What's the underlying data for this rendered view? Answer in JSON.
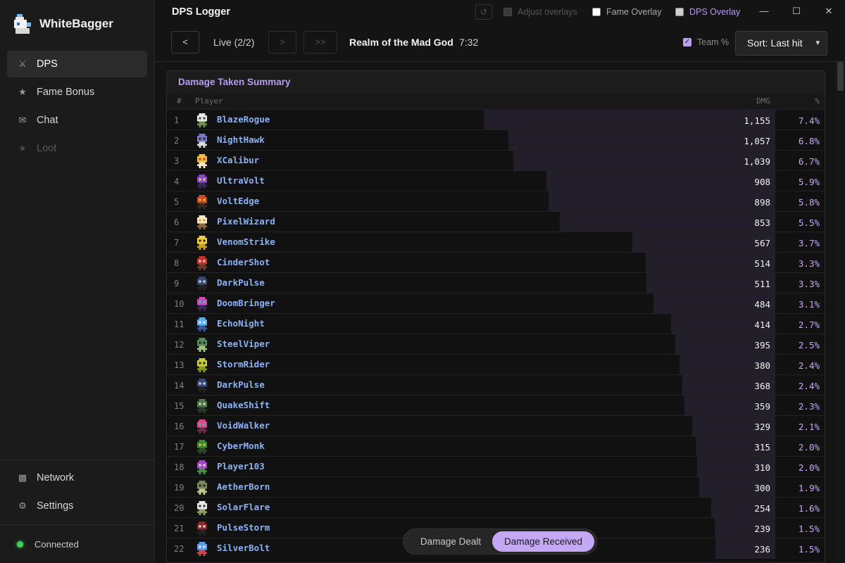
{
  "sidebar": {
    "brand": "WhiteBagger",
    "items": [
      {
        "label": "DPS",
        "icon": "sword-icon",
        "glyph": "⚔"
      },
      {
        "label": "Fame Bonus",
        "icon": "star-icon",
        "glyph": "★"
      },
      {
        "label": "Chat",
        "icon": "mail-icon",
        "glyph": "✉"
      },
      {
        "label": "Loot",
        "icon": "star-icon",
        "glyph": "★"
      }
    ],
    "bottom_items": [
      {
        "label": "Network",
        "icon": "network-icon",
        "glyph": "▩"
      },
      {
        "label": "Settings",
        "icon": "gear-icon",
        "glyph": "⚙"
      }
    ],
    "status": "Connected"
  },
  "titlebar": {
    "title": "DPS Logger",
    "refresh_glyph": "↺",
    "adjust_overlays": "Adjust overlays",
    "fame_overlay": "Fame Overlay",
    "dps_overlay": "DPS Overlay",
    "minimize_glyph": "—",
    "maximize_glyph": "☐",
    "close_glyph": "✕"
  },
  "toolbar": {
    "prev": "<",
    "session": "Live (2/2)",
    "next": ">",
    "last": ">>",
    "realm": "Realm of the Mad God",
    "time": "7:32",
    "team_pct": "Team %",
    "team_check": "✓",
    "sort": "Sort: Last hit",
    "sort_caret": "▾"
  },
  "panel": {
    "title": "Damage Taken Summary",
    "col_rank": "#",
    "col_player": "Player",
    "col_dmg": "DMG",
    "col_pct": "%"
  },
  "players": [
    {
      "rank": 1,
      "name": "BlazeRogue",
      "dmg": "1,155",
      "value": 1155,
      "pct": "7.4%",
      "colors": [
        "#e8e8e8",
        "#444",
        "#6a8f4a"
      ]
    },
    {
      "rank": 2,
      "name": "NightHawk",
      "dmg": "1,057",
      "value": 1057,
      "pct": "6.8%",
      "colors": [
        "#7a7ac8",
        "#222",
        "#dcdcdc"
      ]
    },
    {
      "rank": 3,
      "name": "XCalibur",
      "dmg": "1,039",
      "value": 1039,
      "pct": "6.7%",
      "colors": [
        "#f0c040",
        "#c83030",
        "#f5e6c8"
      ]
    },
    {
      "rank": 4,
      "name": "UltraVolt",
      "dmg": "908",
      "value": 908,
      "pct": "5.9%",
      "colors": [
        "#8a4ac8",
        "#f0d060",
        "#3a2a5a"
      ]
    },
    {
      "rank": 5,
      "name": "VoltEdge",
      "dmg": "898",
      "value": 898,
      "pct": "5.8%",
      "colors": [
        "#c84a2a",
        "#f0c040",
        "#3a2a20"
      ]
    },
    {
      "rank": 6,
      "name": "PixelWizard",
      "dmg": "853",
      "value": 853,
      "pct": "5.5%",
      "colors": [
        "#f5e6c8",
        "#c8a040",
        "#8a6a3a"
      ]
    },
    {
      "rank": 7,
      "name": "VenomStrike",
      "dmg": "567",
      "value": 567,
      "pct": "3.7%",
      "colors": [
        "#f0d040",
        "#222",
        "#c8a020"
      ]
    },
    {
      "rank": 8,
      "name": "CinderShot",
      "dmg": "514",
      "value": 514,
      "pct": "3.3%",
      "colors": [
        "#c83030",
        "#f5d6b8",
        "#6a3a2a"
      ]
    },
    {
      "rank": 9,
      "name": "DarkPulse",
      "dmg": "511",
      "value": 511,
      "pct": "3.3%",
      "colors": [
        "#3a4a7a",
        "#dcdcdc",
        "#222"
      ]
    },
    {
      "rank": 10,
      "name": "DoomBringer",
      "dmg": "484",
      "value": 484,
      "pct": "3.1%",
      "colors": [
        "#c84ac8",
        "#4ac86a",
        "#3a2a5a"
      ]
    },
    {
      "rank": 11,
      "name": "EchoNight",
      "dmg": "414",
      "value": 414,
      "pct": "2.7%",
      "colors": [
        "#5ab0f0",
        "#f0f0f0",
        "#3a5aa0"
      ]
    },
    {
      "rank": 12,
      "name": "SteelViper",
      "dmg": "395",
      "value": 395,
      "pct": "2.5%",
      "colors": [
        "#5a8a5a",
        "#222",
        "#a0c080"
      ]
    },
    {
      "rank": 13,
      "name": "StormRider",
      "dmg": "380",
      "value": 380,
      "pct": "2.4%",
      "colors": [
        "#c8d040",
        "#222",
        "#8a9a20"
      ]
    },
    {
      "rank": 14,
      "name": "DarkPulse",
      "dmg": "368",
      "value": 368,
      "pct": "2.4%",
      "colors": [
        "#3a4a7a",
        "#dcdcdc",
        "#222"
      ]
    },
    {
      "rank": 15,
      "name": "QuakeShift",
      "dmg": "359",
      "value": 359,
      "pct": "2.3%",
      "colors": [
        "#4a7a4a",
        "#f5d6b8",
        "#2a3a2a"
      ]
    },
    {
      "rank": 16,
      "name": "VoidWalker",
      "dmg": "329",
      "value": 329,
      "pct": "2.1%",
      "colors": [
        "#e04a8a",
        "#40c0a0",
        "#6a2a4a"
      ]
    },
    {
      "rank": 17,
      "name": "CyberMonk",
      "dmg": "315",
      "value": 315,
      "pct": "2.0%",
      "colors": [
        "#3a8a3a",
        "#f0c040",
        "#2a4a2a"
      ]
    },
    {
      "rank": 18,
      "name": "Player103",
      "dmg": "310",
      "value": 310,
      "pct": "2.0%",
      "colors": [
        "#a04ac8",
        "#f5d6b8",
        "#4a8a4a"
      ]
    },
    {
      "rank": 19,
      "name": "AetherBorn",
      "dmg": "300",
      "value": 300,
      "pct": "1.9%",
      "colors": [
        "#7a8a5a",
        "#222",
        "#c0c090"
      ]
    },
    {
      "rank": 20,
      "name": "SolarFlare",
      "dmg": "254",
      "value": 254,
      "pct": "1.6%",
      "colors": [
        "#e8e8e8",
        "#333",
        "#8aa060"
      ]
    },
    {
      "rank": 21,
      "name": "PulseStorm",
      "dmg": "239",
      "value": 239,
      "pct": "1.5%",
      "colors": [
        "#8a2a2a",
        "#f0f0f0",
        "#222"
      ]
    },
    {
      "rank": 22,
      "name": "SilverBolt",
      "dmg": "236",
      "value": 236,
      "pct": "1.5%",
      "colors": [
        "#5aa0f0",
        "#f0f0f0",
        "#c84a4a"
      ]
    }
  ],
  "toggle": {
    "dealt": "Damage Dealt",
    "received": "Damage Received"
  },
  "colors": {
    "accent": "#c4a8f6",
    "player_name": "#8ab2f5",
    "status_green": "#3fcf5a"
  }
}
